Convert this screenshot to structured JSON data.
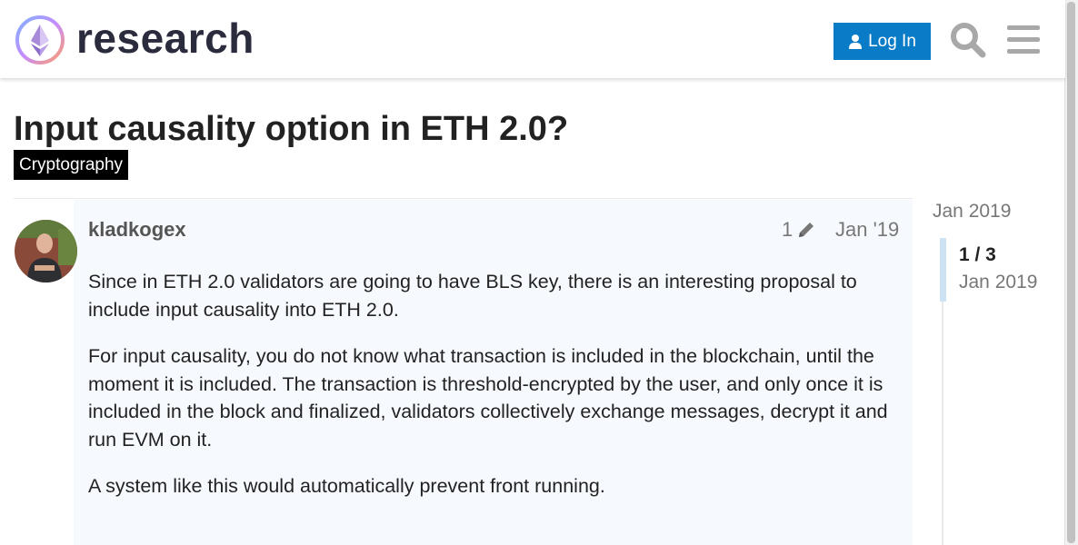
{
  "header": {
    "site_name": "research",
    "login_label": "Log In",
    "icons": {
      "logo": "ethereum-research-logo",
      "user": "user-icon",
      "search": "search-icon",
      "menu": "hamburger-menu-icon"
    }
  },
  "topic": {
    "title": "Input causality option in ETH 2.0?",
    "category": "Cryptography",
    "category_color": "#000000"
  },
  "post": {
    "username": "kladkogex",
    "edit_count": "1",
    "edit_icon": "pencil-icon",
    "date": "Jan '19",
    "paragraphs": [
      "Since in ETH 2.0 validators are going to have BLS key, there is an interesting proposal to include input causality into ETH 2.0.",
      "For input causality, you do not know what transaction is included in the blockchain, until the moment it is included. The transaction is threshold-encrypted by the user, and only once it is included in the block and finalized, validators collectively exchange messages, decrypt it and run EVM on it.",
      "A system like this would automatically prevent front running."
    ]
  },
  "timeline": {
    "top_date": "Jan 2019",
    "position": "1 / 3",
    "current_date": "Jan 2019"
  },
  "colors": {
    "accent": "#0a7cc7",
    "post_background": "#f6fafe",
    "timeline_handle": "#cde3f4"
  }
}
